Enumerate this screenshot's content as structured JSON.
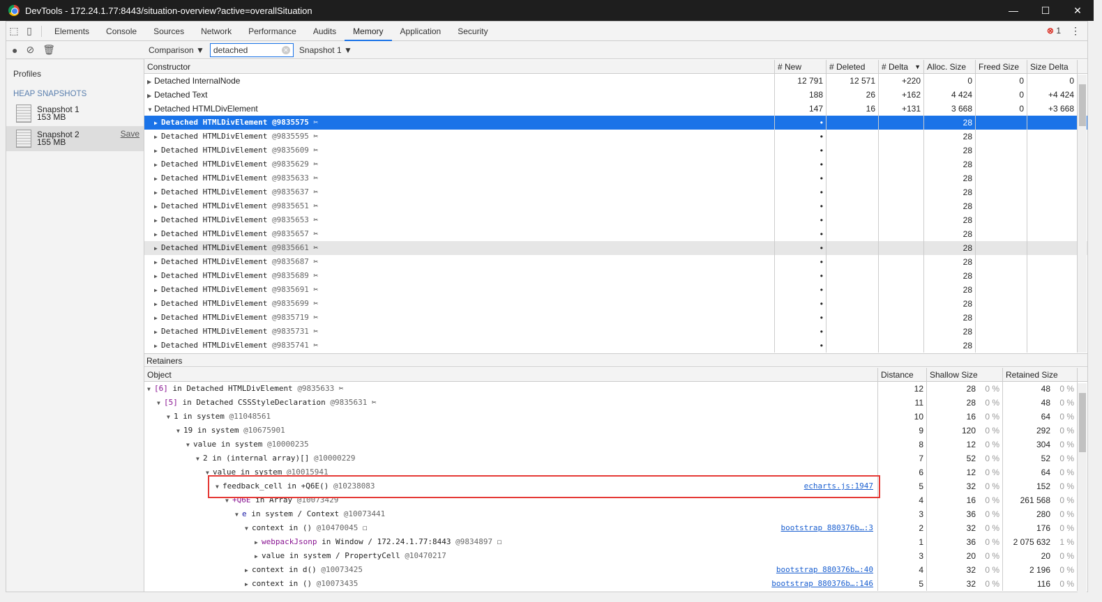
{
  "window": {
    "title": "DevTools - 172.24.1.77:8443/situation-overview?active=overallSituation",
    "controls": [
      "—",
      "☐",
      "✕"
    ]
  },
  "tabs": [
    "Elements",
    "Console",
    "Sources",
    "Network",
    "Performance",
    "Audits",
    "Memory",
    "Application",
    "Security"
  ],
  "active_tab": "Memory",
  "error_count": "1",
  "sidebar": {
    "profiles_label": "Profiles",
    "section": "HEAP SNAPSHOTS",
    "snapshots": [
      {
        "name": "Snapshot 1",
        "size": "153 MB"
      },
      {
        "name": "Snapshot 2",
        "size": "155 MB",
        "save": "Save"
      }
    ]
  },
  "toolbar": {
    "view": "Comparison",
    "filter_value": "detached",
    "base_snapshot": "Snapshot 1"
  },
  "summary": {
    "columns": [
      "Constructor",
      "# New",
      "# Deleted",
      "# Delta",
      "Alloc. Size",
      "Freed Size",
      "Size Delta"
    ],
    "groups": [
      {
        "name": "Detached InternalNode",
        "expanded": false,
        "values": [
          "12 791",
          "12 571",
          "+220",
          "0",
          "0",
          "0"
        ]
      },
      {
        "name": "Detached Text",
        "expanded": false,
        "values": [
          "188",
          "26",
          "+162",
          "4 424",
          "0",
          "+4 424"
        ]
      },
      {
        "name": "Detached HTMLDivElement",
        "expanded": true,
        "values": [
          "147",
          "16",
          "+131",
          "3 668",
          "0",
          "+3 668"
        ]
      }
    ],
    "child_name": "Detached HTMLDivElement",
    "child_ids": [
      "@9835575",
      "@9835595",
      "@9835609",
      "@9835629",
      "@9835633",
      "@9835637",
      "@9835651",
      "@9835653",
      "@9835657",
      "@9835661",
      "@9835687",
      "@9835689",
      "@9835691",
      "@9835699",
      "@9835719",
      "@9835731",
      "@9835741"
    ],
    "child_new": "•",
    "child_alloc": "28",
    "selected_index": 0,
    "hover_index": 9
  },
  "retainers": {
    "title": "Retainers",
    "columns": [
      "Object",
      "Distance",
      "Shallow Size",
      "Retained Size"
    ],
    "rows": [
      {
        "depth": 0,
        "open": true,
        "key": "[6]",
        "keyClass": "purple",
        "text": " in Detached HTMLDivElement ",
        "id": "@9835633",
        "detach": true,
        "dist": "12",
        "shallow": "28",
        "sp": "0 %",
        "retained": "48",
        "rp": "0 %"
      },
      {
        "depth": 1,
        "open": true,
        "key": "[5]",
        "keyClass": "purple",
        "text": " in Detached CSSStyleDeclaration ",
        "id": "@9835631",
        "detach": true,
        "dist": "11",
        "shallow": "28",
        "sp": "0 %",
        "retained": "48",
        "rp": "0 %"
      },
      {
        "depth": 2,
        "open": true,
        "key": "1",
        "text": " in system ",
        "id": "@11048561",
        "dist": "10",
        "shallow": "16",
        "sp": "0 %",
        "retained": "64",
        "rp": "0 %"
      },
      {
        "depth": 3,
        "open": true,
        "key": "19",
        "text": " in system ",
        "id": "@10675901",
        "dist": "9",
        "shallow": "120",
        "sp": "0 %",
        "retained": "292",
        "rp": "0 %"
      },
      {
        "depth": 4,
        "open": true,
        "key": "value",
        "text": " in system ",
        "id": "@10000235",
        "dist": "8",
        "shallow": "12",
        "sp": "0 %",
        "retained": "304",
        "rp": "0 %"
      },
      {
        "depth": 5,
        "open": true,
        "key": "2",
        "text": " in (internal array)[] ",
        "id": "@10000229",
        "dist": "7",
        "shallow": "52",
        "sp": "0 %",
        "retained": "52",
        "rp": "0 %"
      },
      {
        "depth": 6,
        "open": true,
        "key": "value",
        "text": " in system ",
        "id": "@10015941",
        "dist": "6",
        "shallow": "12",
        "sp": "0 %",
        "retained": "64",
        "rp": "0 %"
      },
      {
        "depth": 7,
        "open": true,
        "key": "feedback_cell",
        "text": " in +Q6E() ",
        "id": "@10238083",
        "link": "echarts.js:1947",
        "dist": "5",
        "shallow": "32",
        "sp": "0 %",
        "retained": "152",
        "rp": "0 %"
      },
      {
        "depth": 8,
        "open": true,
        "key": "+Q6E",
        "keyClass": "purple",
        "text": " in Array ",
        "id": "@10073429",
        "dist": "4",
        "shallow": "16",
        "sp": "0 %",
        "retained": "261 568",
        "rp": "0 %"
      },
      {
        "depth": 9,
        "open": true,
        "key": "e",
        "keyClass": "blue",
        "text": " in system / Context ",
        "id": "@10073441",
        "dist": "3",
        "shallow": "36",
        "sp": "0 %",
        "retained": "280",
        "rp": "0 %"
      },
      {
        "depth": 10,
        "open": true,
        "key": "context",
        "text": " in () ",
        "id": "@10470045",
        "box": true,
        "link": "bootstrap 880376b…:3",
        "dist": "2",
        "shallow": "32",
        "sp": "0 %",
        "retained": "176",
        "rp": "0 %"
      },
      {
        "depth": 11,
        "open": false,
        "key": "webpackJsonp",
        "keyClass": "purple",
        "text": " in Window / 172.24.1.77:8443 ",
        "id": "@9834897",
        "box": true,
        "dist": "1",
        "shallow": "36",
        "sp": "0 %",
        "retained": "2 075 632",
        "rp": "1 %"
      },
      {
        "depth": 11,
        "open": false,
        "key": "value",
        "text": " in system / PropertyCell ",
        "id": "@10470217",
        "dist": "3",
        "shallow": "20",
        "sp": "0 %",
        "retained": "20",
        "rp": "0 %"
      },
      {
        "depth": 10,
        "open": false,
        "key": "context",
        "text": " in d() ",
        "id": "@10073425",
        "link": "bootstrap 880376b…:40",
        "dist": "4",
        "shallow": "32",
        "sp": "0 %",
        "retained": "2 196",
        "rp": "0 %"
      },
      {
        "depth": 10,
        "open": false,
        "key": "context",
        "text": " in () ",
        "id": "@10073435",
        "link": "bootstrap 880376b…:146",
        "dist": "5",
        "shallow": "32",
        "sp": "0 %",
        "retained": "116",
        "rp": "0 %"
      }
    ]
  }
}
